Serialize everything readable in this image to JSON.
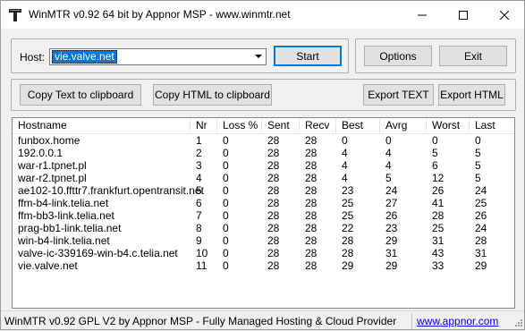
{
  "window": {
    "title": "WinMTR v0.92 64 bit by Appnor MSP - www.winmtr.net"
  },
  "host": {
    "label": "Host:",
    "value": "vie.valve.net"
  },
  "buttons": {
    "start": "Start",
    "options": "Options",
    "exit": "Exit",
    "copy_text": "Copy Text to clipboard",
    "copy_html": "Copy HTML to clipboard",
    "export_text": "Export TEXT",
    "export_html": "Export HTML"
  },
  "table": {
    "columns": [
      "Hostname",
      "Nr",
      "Loss %",
      "Sent",
      "Recv",
      "Best",
      "Avrg",
      "Worst",
      "Last"
    ],
    "rows": [
      [
        "funbox.home",
        "1",
        "0",
        "28",
        "28",
        "0",
        "0",
        "0",
        "0"
      ],
      [
        "192.0.0.1",
        "2",
        "0",
        "28",
        "28",
        "4",
        "4",
        "5",
        "5"
      ],
      [
        "war-r1.tpnet.pl",
        "3",
        "0",
        "28",
        "28",
        "4",
        "4",
        "6",
        "5"
      ],
      [
        "war-r2.tpnet.pl",
        "4",
        "0",
        "28",
        "28",
        "4",
        "5",
        "12",
        "5"
      ],
      [
        "ae102-10.ffttr7.frankfurt.opentransit.net",
        "5",
        "0",
        "28",
        "28",
        "23",
        "24",
        "26",
        "24"
      ],
      [
        "ffm-b4-link.telia.net",
        "6",
        "0",
        "28",
        "28",
        "25",
        "27",
        "41",
        "25"
      ],
      [
        "ffm-bb3-link.telia.net",
        "7",
        "0",
        "28",
        "28",
        "25",
        "26",
        "28",
        "26"
      ],
      [
        "prag-bb1-link.telia.net",
        "8",
        "0",
        "28",
        "28",
        "22",
        "23",
        "25",
        "24"
      ],
      [
        "win-b4-link.telia.net",
        "9",
        "0",
        "28",
        "28",
        "28",
        "29",
        "31",
        "28"
      ],
      [
        "valve-ic-339169-win-b4.c.telia.net",
        "10",
        "0",
        "28",
        "28",
        "28",
        "31",
        "43",
        "31"
      ],
      [
        "vie.valve.net",
        "11",
        "0",
        "28",
        "28",
        "29",
        "29",
        "33",
        "29"
      ]
    ]
  },
  "status": {
    "text": "WinMTR v0.92 GPL V2 by Appnor MSP - Fully Managed Hosting & Cloud Provider",
    "link": "www.appnor.com"
  }
}
